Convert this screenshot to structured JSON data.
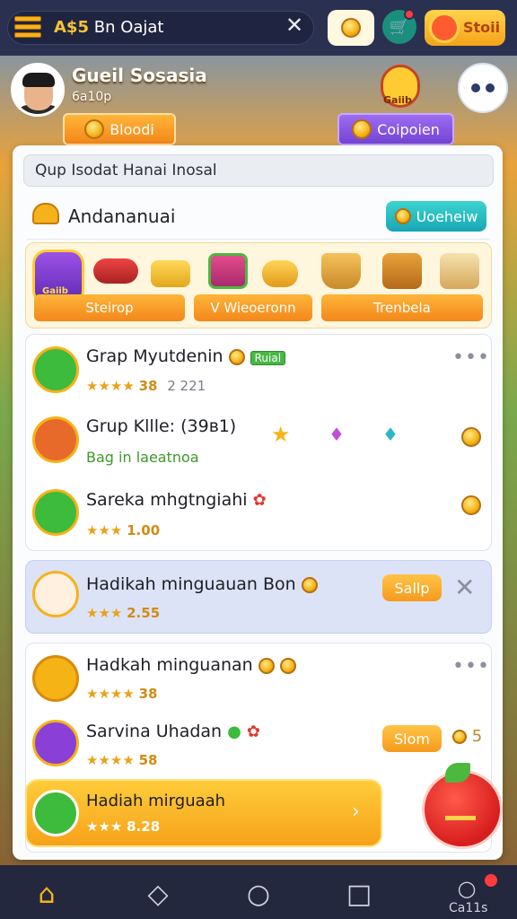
{
  "topbar": {
    "title_prefix": "A$5",
    "title": "Bn Oajat",
    "close_icon": "close-icon",
    "store_label": "Stoii"
  },
  "profile": {
    "name": "Gueil Sosasia",
    "subtitle": "6a10p",
    "blood_button": "Bloodi",
    "coupon_button": "Coipoien",
    "mascot_label": "Gaiib"
  },
  "search": {
    "value": "Qup Isodat Hanai Inosal"
  },
  "section": {
    "title": "Andananuai",
    "view_button": "Uoeheiw"
  },
  "shelf": {
    "game_icon_label": "Gaiib",
    "buttons": [
      "Steirop",
      "V Wieoeronn",
      "Trenbela"
    ]
  },
  "list": [
    {
      "title": "Grap Myutdenin",
      "badge": "Ruial",
      "stars": "★★★★",
      "score": "38",
      "extra": "2 221"
    },
    {
      "title": "Grup Kllle: (39ʙ1)",
      "sub": "Bag in laeatnoa"
    },
    {
      "title": "Sareka mhgtngiahi",
      "stars": "★★★",
      "score": "1.00"
    },
    {
      "title": "Hadikah minguauan",
      "suffix": "Bon",
      "stars": "★★★",
      "score": "2.55",
      "button": "Sallp"
    },
    {
      "title": "Hadkah minguanan",
      "stars": "★★★★",
      "score": "38"
    },
    {
      "title": "Sarvina Uhadan",
      "stars": "★★★★",
      "score": "58",
      "button": "Slom",
      "count": "5"
    },
    {
      "title": "Hadiah mirguaah",
      "stars": "★★★",
      "score": "8.28"
    }
  ],
  "bottomnav": {
    "last_label": "Ca11s"
  },
  "colors": {
    "accent_orange": "#f3871a",
    "accent_purple": "#7444d6",
    "accent_teal": "#1aa6b5",
    "nav_bg": "#23283f"
  }
}
